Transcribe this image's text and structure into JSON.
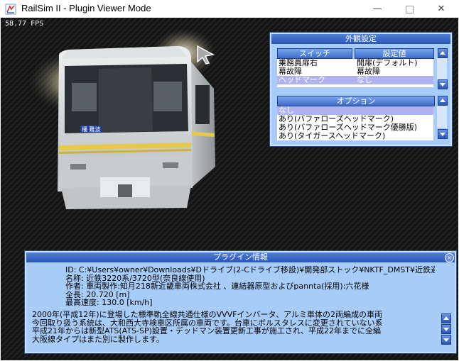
{
  "window": {
    "title": "RailSim II - Plugin Viewer Mode",
    "minimize_glyph": "—",
    "close_glyph": "✕"
  },
  "viewport": {
    "fps": "58.77 FPS",
    "train_dest_sign": "橿 難波"
  },
  "appearance_panel": {
    "title": "外観設定",
    "switch_headers": [
      "スイッチ",
      "設定値"
    ],
    "switch_rows": [
      {
        "name": "乗務員扉右",
        "value": "開扉(デフォルト)"
      },
      {
        "name": "幕故障",
        "value": "幕故障"
      },
      {
        "name": "ヘッドマーク",
        "value": "なし"
      }
    ],
    "options_header": "オプション",
    "options": [
      "なし",
      "あり(バファローズヘッドマーク)",
      "あり(バファローズヘッドマーク優勝版)",
      "あり(タイガースヘッドマーク)"
    ]
  },
  "plugin_info": {
    "title": "プラグイン情報",
    "close_glyph": "×",
    "fields": [
      "ID: C:¥Users¥owner¥Downloads¥Dドライブ(2-Cドライブ移設)¥開発部ストック¥NKTF_DMST¥近鉄通勤",
      "名称: 近鉄3220系/3720型(奈良線使用)",
      "作者: 車両製作:知月218新近畿車両株式会社 、連結器原型およびpannta(採用):六花様",
      "全長: 20.720 [m]",
      "最高速度: 130.0 [km/h]"
    ],
    "description": [
      "2000年(平成12年)に登場した標準軌全線共通仕様のVVVFインバータ、アルミ車体の2両編成の車両",
      "今回取り扱う系統は、大和西大寺検車区所属の車両です。台車にボルスタレスに変更されていない系",
      "平成21年からは新型ATS(ATS-SP)設置・デッドマン装置更新工事が施工され、平成22年までに全編",
      "大阪線タイプはまた別に製作します。"
    ]
  },
  "colors": {
    "panel_bg": "#a8ccf8",
    "header_blue": "#3d6bc8",
    "selection": "#b0b3f0",
    "train_stripe": "#e6c84a",
    "train_body": "#d9dde0"
  }
}
